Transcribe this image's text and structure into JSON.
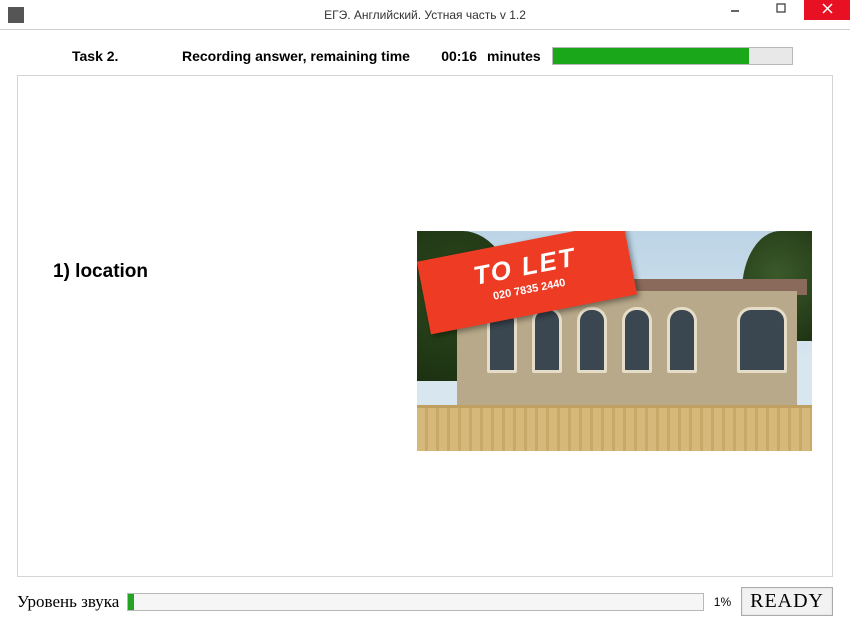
{
  "window": {
    "title": "ЕГЭ. Английский. Устная часть v 1.2"
  },
  "header": {
    "task_label": "Task 2.",
    "status_label": "Recording answer, remaining time",
    "time_value": "00:16",
    "minutes_label": "minutes",
    "progress_percent": 82
  },
  "content": {
    "prompt": "1) location",
    "sign_main": "TO LET",
    "sign_sub": "020 7835 2440"
  },
  "footer": {
    "sound_label": "Уровень звука",
    "sound_percent": 1,
    "sound_percent_label": "1%",
    "ready_label": "READY"
  }
}
